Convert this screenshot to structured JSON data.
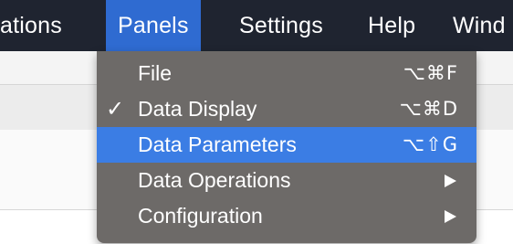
{
  "menubar": {
    "items": [
      {
        "label": "ations"
      },
      {
        "label": "Panels",
        "active": true
      },
      {
        "label": "Settings"
      },
      {
        "label": "Help"
      },
      {
        "label": "Wind"
      }
    ]
  },
  "panels_menu": {
    "items": [
      {
        "label": "File",
        "checked": false,
        "shortcut": "⌥⌘F",
        "submenu": false
      },
      {
        "label": "Data Display",
        "checked": true,
        "check_mark": "✓",
        "shortcut": "⌥⌘D",
        "submenu": false
      },
      {
        "label": "Data Parameters",
        "checked": false,
        "shortcut": "⌥⇧G",
        "submenu": false,
        "highlighted": true
      },
      {
        "label": "Data Operations",
        "checked": false,
        "shortcut": "",
        "submenu": true,
        "icon": "chevron-right-icon"
      },
      {
        "label": "Configuration",
        "checked": false,
        "shortcut": "",
        "submenu": true,
        "icon": "chevron-right-icon"
      }
    ]
  },
  "colors": {
    "menubar_bg": "#1f2430",
    "menubar_active": "#2f6bd1",
    "menu_bg": "#6d6a68",
    "menu_highlight": "#3b7de4",
    "text": "#ffffff"
  }
}
